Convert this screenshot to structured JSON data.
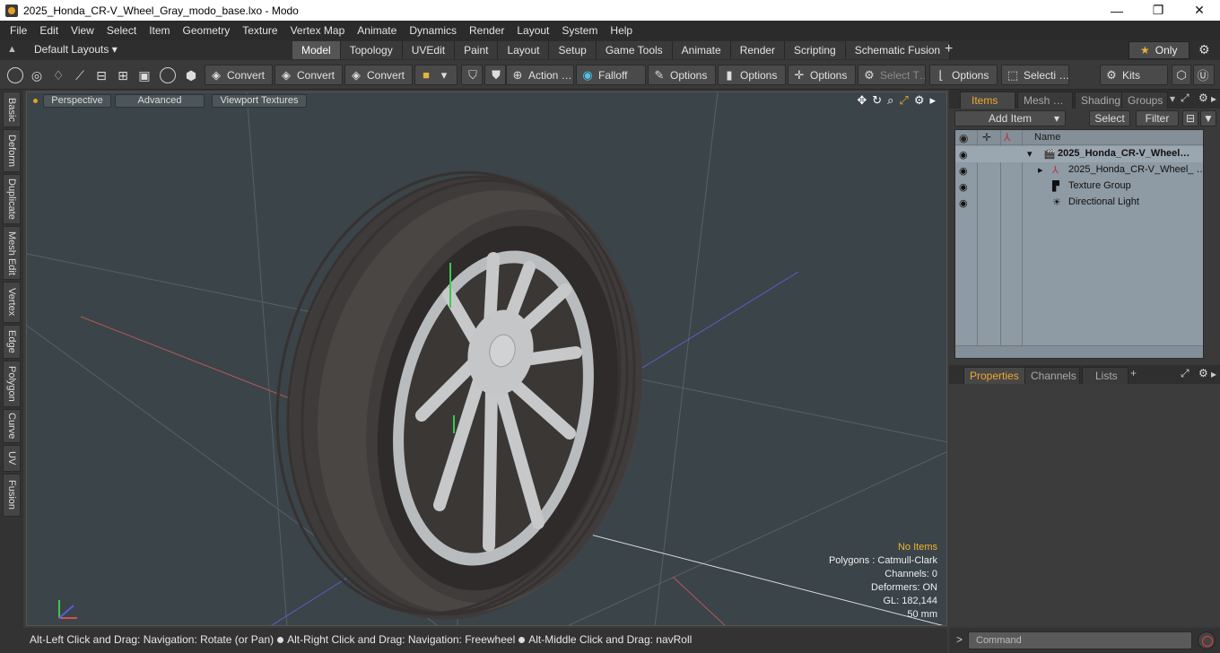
{
  "window": {
    "title": "2025_Honda_CR-V_Wheel_Gray_modo_base.lxo - Modo",
    "controls": {
      "minimize": "—",
      "maximize": "❐",
      "close": "✕"
    }
  },
  "menu": [
    "File",
    "Edit",
    "View",
    "Select",
    "Item",
    "Geometry",
    "Texture",
    "Vertex Map",
    "Animate",
    "Dynamics",
    "Render",
    "Layout",
    "System",
    "Help"
  ],
  "layouts": {
    "label": "Default Layouts ▾"
  },
  "tabs": [
    "Model",
    "Topology",
    "UVEdit",
    "Paint",
    "Layout",
    "Setup",
    "Game Tools",
    "Animate",
    "Render",
    "Scripting",
    "Schematic Fusion"
  ],
  "active_tab": "Model",
  "only_label": "Only",
  "toolbar": {
    "convert1": "Convert",
    "convert2": "Convert",
    "convert3": "Convert",
    "action": "Action …",
    "falloff": "Falloff",
    "options1": "Options",
    "options2": "Options",
    "options3": "Options",
    "select_t": "Select T…",
    "options4": "Options",
    "selecti": "Selecti …",
    "kits": "Kits"
  },
  "left_tabs": [
    "Basic",
    "Deform",
    "Duplicate",
    "Mesh Edit",
    "Vertex",
    "Edge",
    "Polygon",
    "Curve",
    "UV",
    "Fusion"
  ],
  "viewport": {
    "perspective": "Perspective",
    "advanced": "Advanced",
    "textures": "Viewport Textures",
    "info": {
      "no_items": "No Items",
      "polygons": "Polygons : Catmull-Clark",
      "channels": "Channels: 0",
      "deformers": "Deformers: ON",
      "gl": "GL: 182,144",
      "scale": "50 mm"
    }
  },
  "status": {
    "part1": "Alt-Left Click and Drag: Navigation: Rotate (or Pan)",
    "part2": "Alt-Right Click and Drag: Navigation: Freewheel",
    "part3": "Alt-Middle Click and Drag: navRoll"
  },
  "items_panel": {
    "tabs": [
      "Items",
      "Mesh …",
      "Shading",
      "Groups"
    ],
    "add_item": "Add Item",
    "select": "Select",
    "filter": "Filter",
    "name_header": "Name",
    "rows": [
      {
        "label": "2025_Honda_CR-V_Wheel…",
        "type": "scene"
      },
      {
        "label": "2025_Honda_CR-V_Wheel_ …",
        "type": "mesh"
      },
      {
        "label": "Texture Group",
        "type": "texture"
      },
      {
        "label": "Directional Light",
        "type": "light"
      }
    ]
  },
  "props_panel": {
    "tabs": [
      "Properties",
      "Channels",
      "Lists"
    ],
    "plus": "+"
  },
  "command": {
    "placeholder": "Command",
    "prompt": ">"
  },
  "colors": {
    "accent": "#f0a830",
    "viewport_bg": "#3b4448",
    "tire": "#4a4644",
    "rim": "#b9bcbe"
  }
}
